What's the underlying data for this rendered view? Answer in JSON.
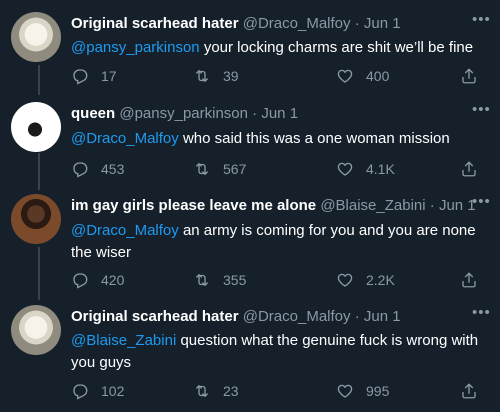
{
  "tweets": [
    {
      "name": "Original scarhead hater",
      "handle": "@Draco_Malfoy",
      "time": "Jun 1",
      "mention": "@pansy_parkinson",
      "text": "your locking charms are shit we’ll be fine",
      "replies": "17",
      "retweets": "39",
      "likes": "400"
    },
    {
      "name": "queen",
      "handle": "@pansy_parkinson",
      "time": "Jun 1",
      "mention": "@Draco_Malfoy",
      "text": "who said this was a one woman mission",
      "replies": "453",
      "retweets": "567",
      "likes": "4.1K"
    },
    {
      "name": "im gay girls please leave me alone",
      "handle": "@Blaise_Zabini",
      "time": "Jun 1",
      "mention": "@Draco_Malfoy",
      "text": "an army is coming for you and you are none the wiser",
      "replies": "420",
      "retweets": "355",
      "likes": "2.2K"
    },
    {
      "name": "Original scarhead hater",
      "handle": "@Draco_Malfoy",
      "time": "Jun 1",
      "mention": "@Blaise_Zabini",
      "text": "question what the genuine fuck is wrong with you guys",
      "replies": "102",
      "retweets": "23",
      "likes": "995"
    }
  ],
  "separator": "·",
  "more_glyph": "•••",
  "colors": {
    "background": "#15202b",
    "mention": "#1d9bf0",
    "muted": "#8b98a5"
  }
}
